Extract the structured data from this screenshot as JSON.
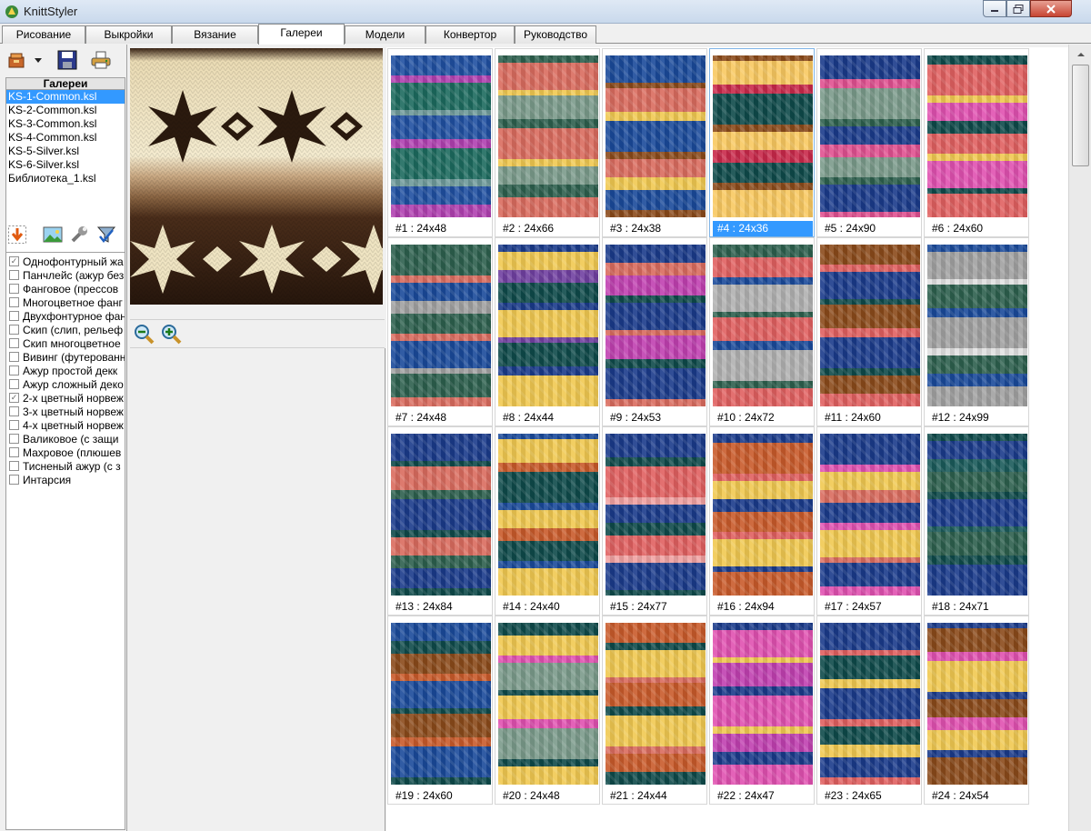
{
  "window": {
    "title": "KnittStyler",
    "app_icon": "knittstyler-logo-icon",
    "controls": [
      "minimize-icon",
      "maximize-icon",
      "close-icon"
    ]
  },
  "tabs": [
    {
      "label": "Рисование"
    },
    {
      "label": "Выкройки"
    },
    {
      "label": "Вязание"
    },
    {
      "label": "Галереи",
      "active": true
    },
    {
      "label": "Модели"
    },
    {
      "label": "Конвертор"
    },
    {
      "label": "Руководство"
    }
  ],
  "toolbar": {
    "icons": [
      "open-folder-icon",
      "dropdown-arrow-icon",
      "save-disk-icon",
      "printer-icon"
    ]
  },
  "galleries": {
    "header": "Галереи",
    "items": [
      "KS-1-Common.ksl",
      "KS-2-Common.ksl",
      "KS-3-Common.ksl",
      "KS-4-Common.ksl",
      "KS-5-Silver.ksl",
      "KS-6-Silver.ksl",
      "Библиотека_1.ksl"
    ],
    "selected_index": 0
  },
  "tools2": {
    "icons": [
      "import-arrow-icon",
      "image-icon",
      "wrench-icon",
      "filter-icon"
    ]
  },
  "categories": [
    {
      "label": "Однофонтурный жа",
      "checked": true
    },
    {
      "label": "Панчлейс (ажур без",
      "checked": false
    },
    {
      "label": "Фанговое (прессов",
      "checked": false
    },
    {
      "label": "Многоцветное фанг",
      "checked": false
    },
    {
      "label": "Двухфонтурное фан",
      "checked": false
    },
    {
      "label": "Скип (слип, рельеф",
      "checked": false
    },
    {
      "label": "Скип многоцветное",
      "checked": false
    },
    {
      "label": "Вивинг (футерованн",
      "checked": false
    },
    {
      "label": "Ажур простой декк",
      "checked": false
    },
    {
      "label": "Ажур сложный деко",
      "checked": false
    },
    {
      "label": "2-х цветный норвеж",
      "checked": true
    },
    {
      "label": "3-х цветный норвеж",
      "checked": false
    },
    {
      "label": "4-х цветный норвеж",
      "checked": false
    },
    {
      "label": "Валиковое (с защи",
      "checked": false
    },
    {
      "label": "Махровое (плюшев",
      "checked": false
    },
    {
      "label": "Тисненый ажур (с з",
      "checked": false
    },
    {
      "label": "Интарсия",
      "checked": false
    }
  ],
  "preview": {
    "zoom_icons": [
      "zoom-out-icon",
      "zoom-in-icon"
    ]
  },
  "patterns": [
    {
      "label": "#1 : 24x48",
      "colors": [
        "#1f4fa0",
        "#b040b0",
        "#1c6a5e",
        "#6e9a9a"
      ]
    },
    {
      "label": "#2 : 24x66",
      "colors": [
        "#2c5f4d",
        "#d96b5e",
        "#f0c850",
        "#7a9a8a"
      ]
    },
    {
      "label": "#3 : 24x38",
      "colors": [
        "#1a4a9a",
        "#8a4a1a",
        "#d96b5e",
        "#f0c850"
      ]
    },
    {
      "label": "#4 : 24x36",
      "colors": [
        "#8a4a1a",
        "#f8c860",
        "#c8284a",
        "#0e4a4a"
      ]
    },
    {
      "label": "#5 : 24x90",
      "colors": [
        "#1a3a8a",
        "#e05090",
        "#7a9a8a",
        "#2c5f4d"
      ]
    },
    {
      "label": "#6 : 24x60",
      "colors": [
        "#0e4a4a",
        "#e06060",
        "#f0c850",
        "#e050b0"
      ]
    },
    {
      "label": "#7 : 24x48",
      "colors": [
        "#2c5f4d",
        "#d96b5e",
        "#1a4a9a",
        "#a0a0a0"
      ]
    },
    {
      "label": "#8 : 24x44",
      "colors": [
        "#1a3a8a",
        "#f0c850",
        "#7040a0",
        "#0e4a4a"
      ]
    },
    {
      "label": "#9 : 24x53",
      "colors": [
        "#1a3a8a",
        "#d96b5e",
        "#c040b0",
        "#0e4a4a"
      ]
    },
    {
      "label": "#10 : 24x72",
      "colors": [
        "#2c5f4d",
        "#e06060",
        "#1a4a9a",
        "#b0b0b0"
      ]
    },
    {
      "label": "#11 : 24x60",
      "colors": [
        "#8a4a1a",
        "#e06060",
        "#1a3a8a",
        "#0e4a4a"
      ]
    },
    {
      "label": "#12 : 24x99",
      "colors": [
        "#1a4a9a",
        "#a0a0a0",
        "#e0e0e0",
        "#2c5f4d"
      ]
    },
    {
      "label": "#13 : 24x84",
      "colors": [
        "#1a3a8a",
        "#0e4a4a",
        "#d96b5e",
        "#2c5f4d"
      ]
    },
    {
      "label": "#14 : 24x40",
      "colors": [
        "#1a4a9a",
        "#f0c850",
        "#c85a2a",
        "#0e4a4a"
      ]
    },
    {
      "label": "#15 : 24x77",
      "colors": [
        "#1a3a8a",
        "#0e4a4a",
        "#e06060",
        "#f0a0a0"
      ]
    },
    {
      "label": "#16 : 24x94",
      "colors": [
        "#1a3a8a",
        "#c85a2a",
        "#e06060",
        "#f0c850"
      ]
    },
    {
      "label": "#17 : 24x57",
      "colors": [
        "#1a3a8a",
        "#e050b0",
        "#f0c850",
        "#d96b5e"
      ]
    },
    {
      "label": "#18 : 24x71",
      "colors": [
        "#0e4a4a",
        "#1a3a8a",
        "#1a5a5a",
        "#2c5f4d"
      ]
    },
    {
      "label": "#19 : 24x60",
      "colors": [
        "#1a4a9a",
        "#0e4a4a",
        "#8a4a1a",
        "#c85a2a"
      ]
    },
    {
      "label": "#20 : 24x48",
      "colors": [
        "#0e4a4a",
        "#f0c850",
        "#e050b0",
        "#7a9a8a"
      ]
    },
    {
      "label": "#21 : 24x44",
      "colors": [
        "#c85a2a",
        "#0e4a4a",
        "#f0c850",
        "#d96b5e"
      ]
    },
    {
      "label": "#22 : 24x47",
      "colors": [
        "#1a3a8a",
        "#e050b0",
        "#f0c850",
        "#c040b0"
      ]
    },
    {
      "label": "#23 : 24x65",
      "colors": [
        "#1a3a8a",
        "#e06060",
        "#0e4a4a",
        "#f0c850"
      ]
    },
    {
      "label": "#24 : 24x54",
      "colors": [
        "#1a3a8a",
        "#8a4a1a",
        "#e050b0",
        "#f0c850"
      ]
    }
  ],
  "selected_pattern_index": 3
}
